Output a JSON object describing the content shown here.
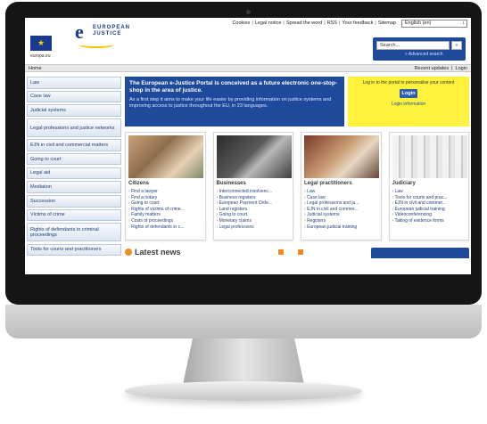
{
  "top_links": [
    "Cookies",
    "Legal notice",
    "Spread the word",
    "RSS",
    "Your feedback",
    "Sitemap"
  ],
  "language": "English (en)",
  "eu_label": "europa.eu",
  "logo": {
    "mark": "e",
    "line1": "EUROPEAN",
    "line2": "JUSTICE"
  },
  "search": {
    "placeholder": "Search...",
    "advanced": "» Advanced search"
  },
  "nav": {
    "home": "Home",
    "recent": "Recent updates",
    "login": "Login"
  },
  "sidebar": [
    "Law",
    "Case law",
    "Judicial systems",
    "Legal professions and justice networks",
    "EJN in civil and commercial matters",
    "Going to court",
    "Legal aid",
    "Mediation",
    "Succession",
    "Victims of crime",
    "Rights of defendants in criminal proceedings",
    "Tools for courts and practitioners"
  ],
  "banner": {
    "title": "The European e-Justice Portal is conceived as a future electronic one-stop-shop in the area of justice.",
    "text": "As a first step it aims to make your life easier by providing information on justice systems and improving access to justice throughout the EU, in 23 languages."
  },
  "login_box": {
    "text": "Log in to the portal to personalise your content",
    "button": "Login",
    "info": "Login information"
  },
  "cards": [
    {
      "title": "Citizens",
      "links": [
        "Find a lawyer",
        "Find a notary",
        "Going to court",
        "Rights of victims of crime...",
        "Family matters",
        "Costs of proceedings",
        "Rights of defendants in c..."
      ]
    },
    {
      "title": "Businesses",
      "links": [
        "Interconnected insolvenc...",
        "Business registers",
        "European Payment Orde...",
        "Land registers",
        "Going to court",
        "Monetary claims",
        "Legal professions"
      ]
    },
    {
      "title": "Legal practitioners",
      "links": [
        "Law",
        "Case law",
        "Legal professions and ju...",
        "EJN in civil and commer...",
        "Judicial systems",
        "Registers",
        "European judicial training"
      ]
    },
    {
      "title": "Judiciary",
      "links": [
        "Law",
        "Tools for courts and prac...",
        "EJN in civil and commer...",
        "European judicial training",
        "Videoconferencing",
        "Taking of evidence forms"
      ]
    }
  ],
  "news": {
    "title": "Latest news"
  }
}
